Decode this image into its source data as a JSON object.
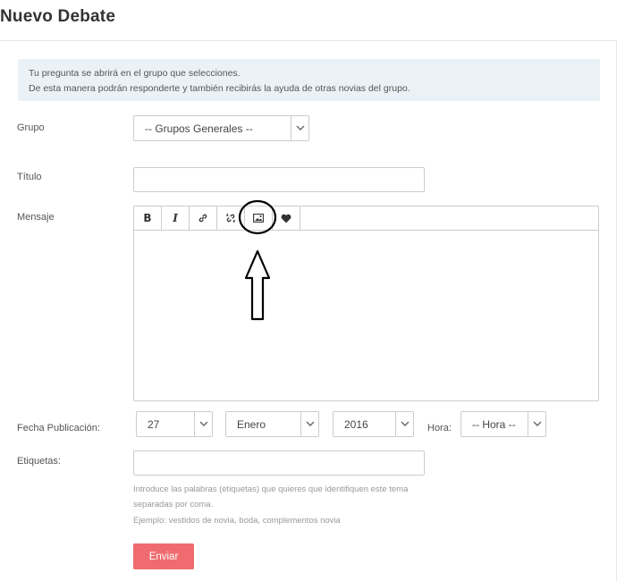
{
  "page": {
    "title": "Nuevo Debate"
  },
  "info": {
    "line1": "Tu pregunta se abrirá en el grupo que selecciones.",
    "line2": "De esta manera podrán responderte y también recibirás la ayuda de otras novias del grupo."
  },
  "form": {
    "grupo": {
      "label": "Grupo",
      "selected": "-- Grupos Generales --"
    },
    "titulo": {
      "label": "Título",
      "value": ""
    },
    "mensaje": {
      "label": "Mensaje"
    },
    "fecha": {
      "label": "Fecha Publicación:",
      "day": "27",
      "month": "Enero",
      "year": "2016"
    },
    "hora": {
      "label": "Hora:",
      "selected": "-- Hora --"
    },
    "etiquetas": {
      "label": "Etiquetas:",
      "value": "",
      "help1": "Introduce las palabras (etiquetas) que quieres que identifiquen este tema",
      "help2": "separadas por coma.",
      "help3": "Ejemplo: vestidos de novia, boda, complementos novia"
    },
    "submit_label": "Enviar"
  },
  "toolbar": {
    "bold": "B",
    "italic": "I",
    "icons": [
      "link-icon",
      "unlink-icon",
      "image-icon",
      "heart-icon"
    ]
  },
  "colors": {
    "accent": "#ef6b6f",
    "info_bg": "#eaf2f7"
  }
}
